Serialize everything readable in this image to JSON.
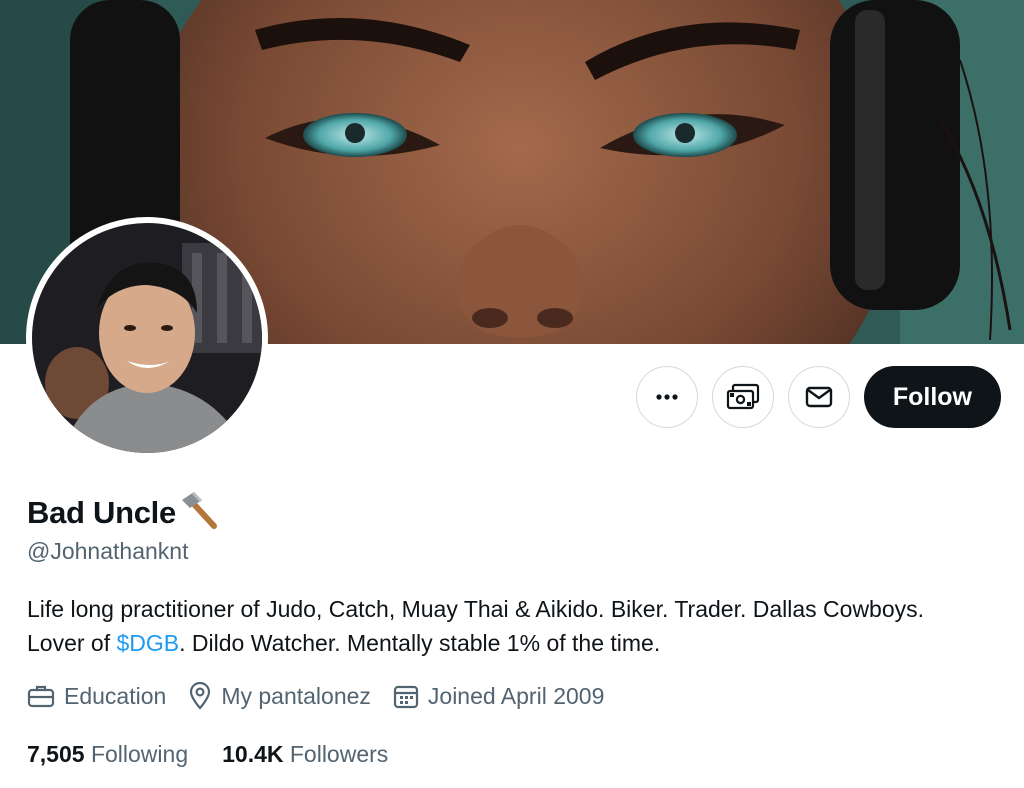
{
  "profile": {
    "display_name": "Bad Uncle",
    "name_emoji": "hammer-emoji",
    "handle": "@Johnathanknt",
    "bio_part1": "Life long practitioner of Judo, Catch, Muay Thai & Aikido. Biker. Trader. Dallas Cowboys. Lover of ",
    "bio_cashtag": "$DGB",
    "bio_part2": ". Dildo Watcher. Mentally stable 1% of the time.",
    "category": "Education",
    "location": "My pantalonez",
    "joined": "Joined April 2009"
  },
  "stats": {
    "following_count": "7,505",
    "following_label": "Following",
    "followers_count": "10.4K",
    "followers_label": "Followers"
  },
  "actions": {
    "more_icon": "more-icon",
    "subscribe_icon": "money-icon",
    "message_icon": "mail-icon",
    "follow_label": "Follow"
  },
  "colors": {
    "accent": "#1d9bf0",
    "text_primary": "#0f1419",
    "text_secondary": "#536471",
    "follow_bg": "#0f1419",
    "banner_teal": "#2f5a55",
    "border": "#cfd9de"
  }
}
